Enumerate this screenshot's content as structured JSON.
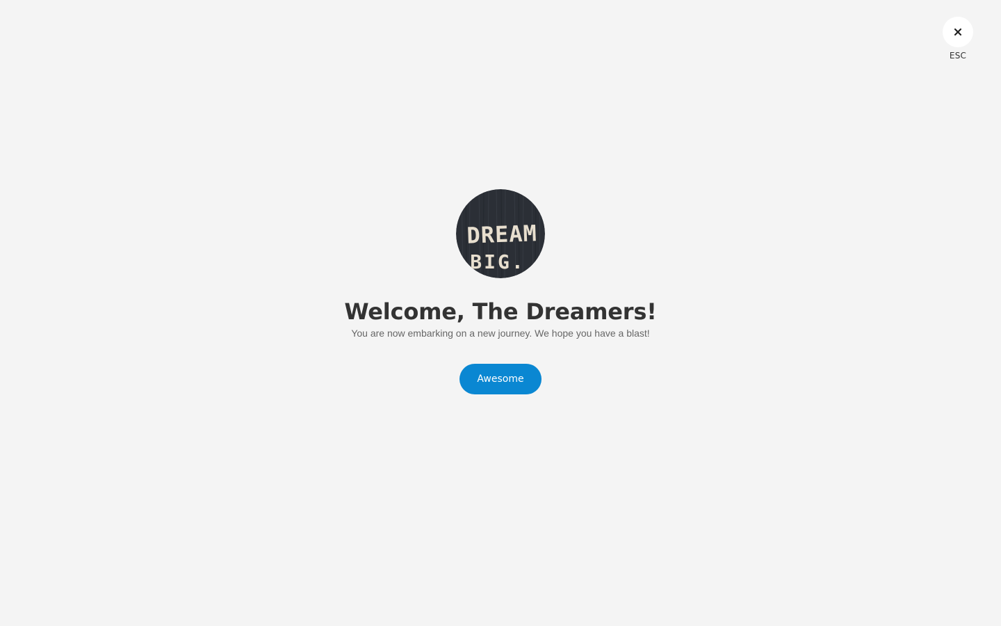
{
  "close": {
    "icon": "close-icon",
    "label": "ESC"
  },
  "welcome": {
    "avatar_icon": "dream-big-avatar",
    "avatar_text_line1": "DREAM",
    "avatar_text_line2": "BIG.",
    "title": "Welcome, The Dreamers!",
    "subtitle": "You are now embarking on a new journey. We hope you have a blast!",
    "button_label": "Awesome"
  },
  "colors": {
    "background": "#f4f4f4",
    "accent": "#0a87d2",
    "title": "#333333",
    "subtitle": "#666666"
  }
}
